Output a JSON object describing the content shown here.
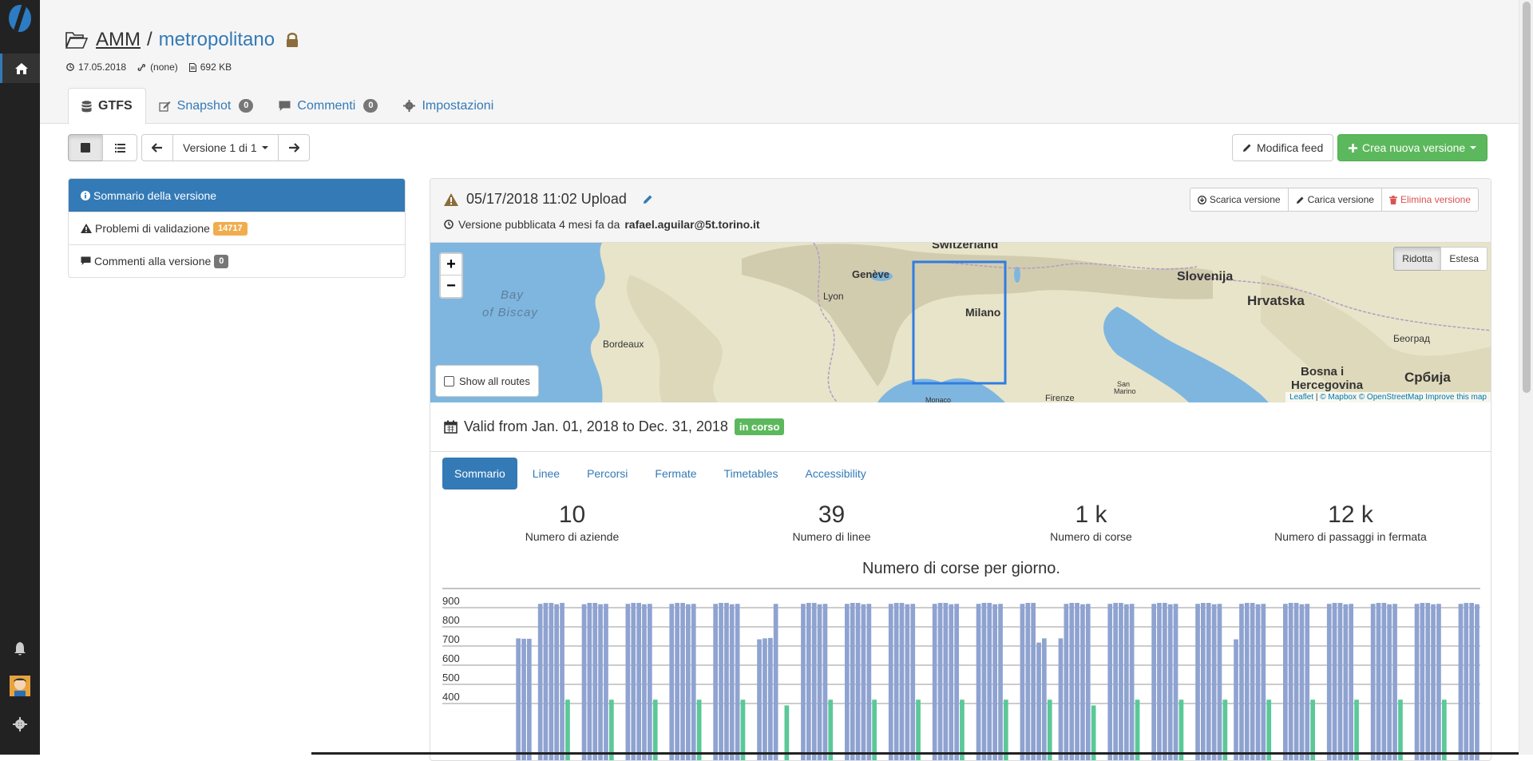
{
  "header": {
    "project": "AMM",
    "separator": "/",
    "feed": "metropolitano",
    "date": "17.05.2018",
    "url": "(none)",
    "size": "692 KB"
  },
  "tabs": [
    {
      "label": "GTFS",
      "badge": null
    },
    {
      "label": "Snapshot",
      "badge": "0"
    },
    {
      "label": "Commenti",
      "badge": "0"
    },
    {
      "label": "Impostazioni",
      "badge": null
    }
  ],
  "toolbar": {
    "version_label": "Versione 1 di 1",
    "edit_feed": "Modifica feed",
    "new_version": "Crea nuova versione"
  },
  "left_list": [
    {
      "label": "Sommario della versione",
      "badge": null
    },
    {
      "label": "Problemi di validazione",
      "badge": "14717"
    },
    {
      "label": "Commenti alla versione",
      "badge": "0"
    }
  ],
  "version": {
    "title": "05/17/2018 11:02 Upload",
    "published_prefix": "Versione pubblicata 4 mesi fa da",
    "published_by": "rafael.aguilar@5t.torino.it",
    "actions": {
      "download": "Scarica versione",
      "upload": "Carica versione",
      "delete": "Elimina versione"
    }
  },
  "map": {
    "zoom_in": "+",
    "zoom_out": "−",
    "mode_reduced": "Ridotta",
    "mode_extended": "Estesa",
    "show_routes": "Show all routes",
    "attribution": {
      "leaflet": "Leaflet",
      "mapbox": "© Mapbox",
      "osm": "© OpenStreetMap",
      "improve": "Improve this map"
    },
    "labels": {
      "switzerland": "Switzerland",
      "geneve": "Genève",
      "lyon": "Lyon",
      "bay1": "Bay",
      "bay2": "of Biscay",
      "bordeaux": "Bordeaux",
      "milano": "Milano",
      "slovenija": "Slovenija",
      "hrvatska": "Hrvatska",
      "beograd": "Београд",
      "bosna1": "Bosna i",
      "bosna2": "Hercegovina",
      "srbija": "Србија",
      "firenze": "Firenze",
      "monaco": "Monaco",
      "sanmarino1": "San",
      "sanmarino2": "Marino"
    }
  },
  "validity": {
    "text": "Valid from Jan. 01, 2018 to Dec. 31, 2018",
    "status": "in corso"
  },
  "subtabs": [
    "Sommario",
    "Linee",
    "Percorsi",
    "Fermate",
    "Timetables",
    "Accessibility"
  ],
  "stats": [
    {
      "value": "10",
      "label": "Numero di aziende"
    },
    {
      "value": "39",
      "label": "Numero di linee"
    },
    {
      "value": "1 k",
      "label": "Numero di corse"
    },
    {
      "value": "12 k",
      "label": "Numero di passaggi in fermata"
    }
  ],
  "colors": {
    "primary": "#337ab7",
    "success": "#5cb85c",
    "warning": "#f0ad4e",
    "bar_trips": "#8fa3d1",
    "bar_secondary": "#5bc898"
  },
  "chart_data": {
    "type": "bar",
    "title": "Numero di corse per giorno.",
    "ylim": [
      350,
      950
    ],
    "yticks": [
      400,
      500,
      600,
      700,
      800,
      900
    ],
    "series": [
      {
        "values": [
          0,
          0,
          0,
          0,
          0,
          740,
          738,
          738,
          0,
          920,
          925,
          925,
          918,
          925,
          0,
          0,
          0,
          918,
          925,
          925,
          918,
          920,
          0,
          0,
          0,
          920,
          925,
          925,
          918,
          920,
          0,
          0,
          0,
          920,
          925,
          925,
          918,
          920,
          0,
          0,
          0,
          920,
          925,
          925,
          918,
          920,
          0,
          0,
          0,
          735,
          740,
          742,
          920,
          0,
          0,
          0,
          0,
          920,
          925,
          925,
          918,
          920,
          0,
          0,
          0,
          920,
          925,
          925,
          918,
          920,
          0,
          0,
          0,
          920,
          925,
          925,
          918,
          920,
          0,
          0,
          0,
          920,
          925,
          925,
          918,
          920,
          0,
          0,
          0,
          920,
          925,
          925,
          918,
          920,
          0,
          0,
          0,
          920,
          925,
          925,
          718,
          740,
          0,
          0,
          740,
          920,
          925,
          925,
          918,
          920,
          0,
          0,
          0,
          920,
          925,
          925,
          918,
          920,
          0,
          0,
          0,
          920,
          925,
          925,
          918,
          920,
          0,
          0,
          0,
          920,
          925,
          925,
          918,
          920,
          0,
          0,
          735,
          920,
          925,
          925,
          918,
          920,
          0,
          0,
          0,
          920,
          925,
          925,
          918,
          920,
          0,
          0,
          0,
          920,
          925,
          925,
          918,
          920,
          0,
          0,
          0,
          920,
          925,
          925,
          918,
          920,
          0,
          0,
          0,
          920,
          925,
          925,
          918,
          920,
          0,
          0,
          0,
          920,
          925,
          925,
          918
        ]
      },
      {
        "values": [
          0,
          0,
          0,
          0,
          0,
          0,
          0,
          0,
          0,
          0,
          0,
          0,
          0,
          0,
          420,
          0,
          0,
          0,
          0,
          0,
          0,
          0,
          420,
          0,
          0,
          0,
          0,
          0,
          0,
          0,
          420,
          0,
          0,
          0,
          0,
          0,
          0,
          0,
          420,
          0,
          0,
          0,
          0,
          0,
          0,
          0,
          420,
          0,
          0,
          0,
          0,
          0,
          0,
          0,
          390,
          0,
          0,
          0,
          0,
          0,
          0,
          0,
          420,
          0,
          0,
          0,
          0,
          0,
          0,
          0,
          420,
          0,
          0,
          0,
          0,
          0,
          0,
          0,
          420,
          0,
          0,
          0,
          0,
          0,
          0,
          0,
          420,
          0,
          0,
          0,
          0,
          0,
          0,
          0,
          420,
          0,
          0,
          0,
          0,
          0,
          0,
          0,
          420,
          0,
          0,
          0,
          0,
          0,
          0,
          0,
          390,
          0,
          0,
          0,
          0,
          0,
          0,
          0,
          420,
          0,
          0,
          0,
          0,
          0,
          0,
          0,
          420,
          0,
          0,
          0,
          0,
          0,
          0,
          0,
          420,
          0,
          0,
          0,
          0,
          0,
          0,
          0,
          420,
          0,
          0,
          0,
          0,
          0,
          0,
          0,
          420,
          0,
          0,
          0,
          0,
          0,
          0,
          0,
          420,
          0,
          0,
          0,
          0,
          0,
          0,
          0,
          420,
          0,
          0,
          0,
          0,
          0,
          0,
          0,
          420,
          0,
          0,
          0,
          0,
          0,
          0,
          0,
          0
        ]
      }
    ]
  }
}
